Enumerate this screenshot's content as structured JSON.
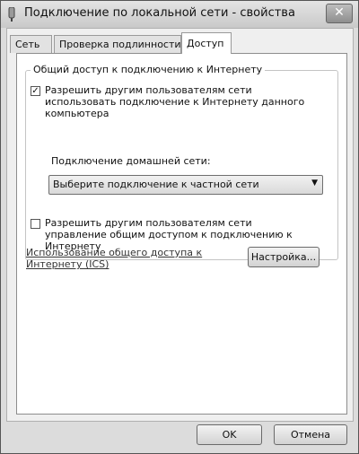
{
  "window": {
    "title": "Подключение по локальной сети - свойства",
    "close_glyph": "✕"
  },
  "tabs": [
    {
      "label": "Сеть"
    },
    {
      "label": "Проверка подлинности"
    },
    {
      "label": "Доступ",
      "active": true
    }
  ],
  "sharing": {
    "group_title": "Общий доступ к подключению к Интернету",
    "allow_connect": {
      "label": "Разрешить другим пользователям сети использовать подключение к Интернету данного компьютера",
      "checked": true,
      "check_glyph": "✓"
    },
    "home_network_label": "Подключение домашней сети:",
    "home_network_select": {
      "value": "Выберите подключение к частной сети",
      "arrow_glyph": "▼"
    },
    "allow_control": {
      "label": "Разрешить другим пользователям сети управление общим доступом к подключению к Интернету",
      "checked": false
    },
    "ics_link": "Использование общего доступа к Интернету (ICS)",
    "settings_button": "Настройка..."
  },
  "footer": {
    "ok": "OK",
    "cancel": "Отмена"
  }
}
